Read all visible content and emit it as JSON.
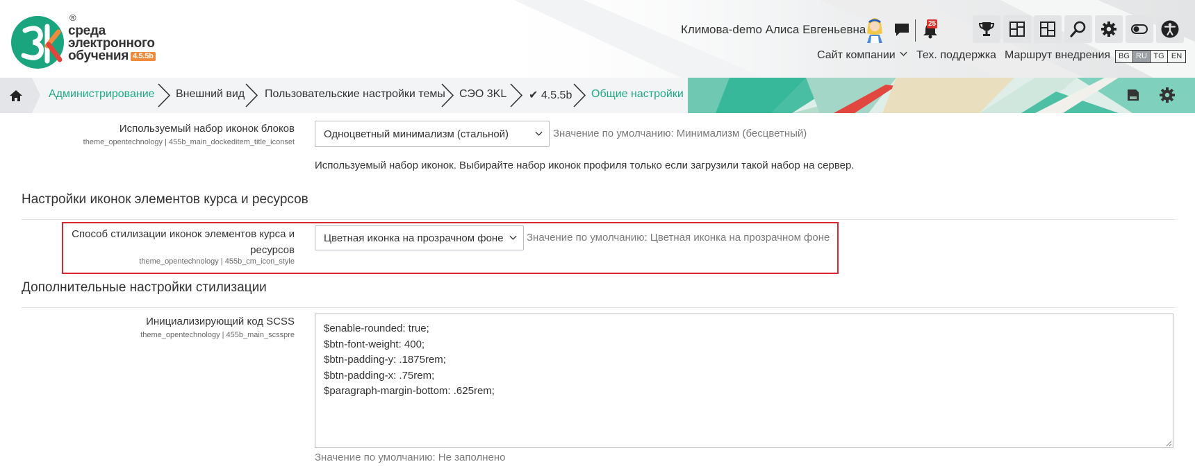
{
  "header": {
    "logo": {
      "mark_text": "3K",
      "reg_symbol": "®",
      "line1": "среда",
      "line2": "электронного",
      "line3": "обучения",
      "version": "4.5.5b"
    },
    "user_name": "Климова-demo Алиса Евгеньевна",
    "notification_count": "25",
    "nav_links": [
      "Сайт компании",
      "Тех. поддержка",
      "Маршрут внедрения"
    ],
    "languages": [
      "BG",
      "RU",
      "TG",
      "EN"
    ],
    "active_language": "RU",
    "toolbar_icons": [
      "trophy-icon",
      "dashboard-icon",
      "layout-icon",
      "search-icon",
      "gear-icon",
      "toggle-icon",
      "accessibility-icon"
    ]
  },
  "breadcrumb": {
    "items": [
      "Администрирование",
      "Внешний вид",
      "Пользовательские настройки темы",
      "СЭО 3KL",
      "✔ 4.5.5b",
      "Общие настройки"
    ]
  },
  "settings": {
    "iconset": {
      "label": "Используемый набор иконок блоков",
      "key": "theme_opentechnology | 455b_main_dockeditem_title_iconset",
      "value": "Одноцветный минимализм (стальной)",
      "default": "Значение по умолчанию: Минимализм (бесцветный)",
      "description": "Используемый набор иконок. Выбирайте набор иконок профиля только если загрузили такой набор на сервер."
    },
    "section_course_icons": "Настройки иконок элементов курса и ресурсов",
    "cm_icon_style": {
      "label_line1": "Способ стилизации иконок элементов курса и",
      "label_line2": "ресурсов",
      "key": "theme_opentechnology | 455b_cm_icon_style",
      "value": "Цветная иконка на прозрачном фоне",
      "default": "Значение по умолчанию: Цветная иконка на прозрачном фоне"
    },
    "section_styling": "Дополнительные настройки стилизации",
    "scss_pre": {
      "label": "Инициализирующий код SCSS",
      "key": "theme_opentechnology | 455b_main_scsspre",
      "lines": [
        "$enable-rounded: true;",
        "$btn-font-weight: 400;",
        "$btn-padding-y: .1875rem;",
        "$btn-padding-x: .75rem;",
        "$paragraph-margin-bottom: .625rem;"
      ],
      "default": "Значение по умолчанию: Не заполнено"
    }
  },
  "colors": {
    "accent_green": "#20a884",
    "highlight_red": "#d9272f",
    "badge_red": "#d9312b",
    "version_orange": "#f08a3c"
  }
}
